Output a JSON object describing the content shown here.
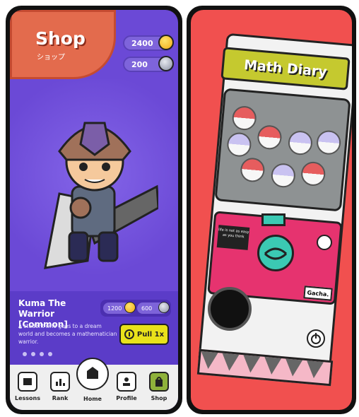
{
  "left_screen": {
    "shop": {
      "title": "Shop",
      "subtitle": "ショップ"
    },
    "currency": {
      "gold": "2400",
      "silver": "200"
    },
    "character": {
      "name": "Kuma The Warrior [Common]",
      "description": "A student who goes to a dream world and becomes a mathematician warrior.",
      "price_gold": "1200",
      "price_silver": "600",
      "pull_label": "Pull 1x"
    },
    "pager": {
      "count": 4
    },
    "tabbar": {
      "lessons": "Lessons",
      "rank": "Rank",
      "home": "Home",
      "profile": "Profile",
      "shop": "Shop"
    }
  },
  "right_screen": {
    "machine_title": "Math Diary",
    "note_text": "life is not as easy as you think",
    "gacha_label": "Gacha."
  },
  "colors": {
    "left_bg": "#6b49d6",
    "shop_banner": "#e36b4d",
    "pull_button": "#e9e21a",
    "right_bg": "#f1504f",
    "machine_panel": "#e6336f",
    "teal": "#3bc9b3",
    "header_green": "#c5c92f"
  }
}
